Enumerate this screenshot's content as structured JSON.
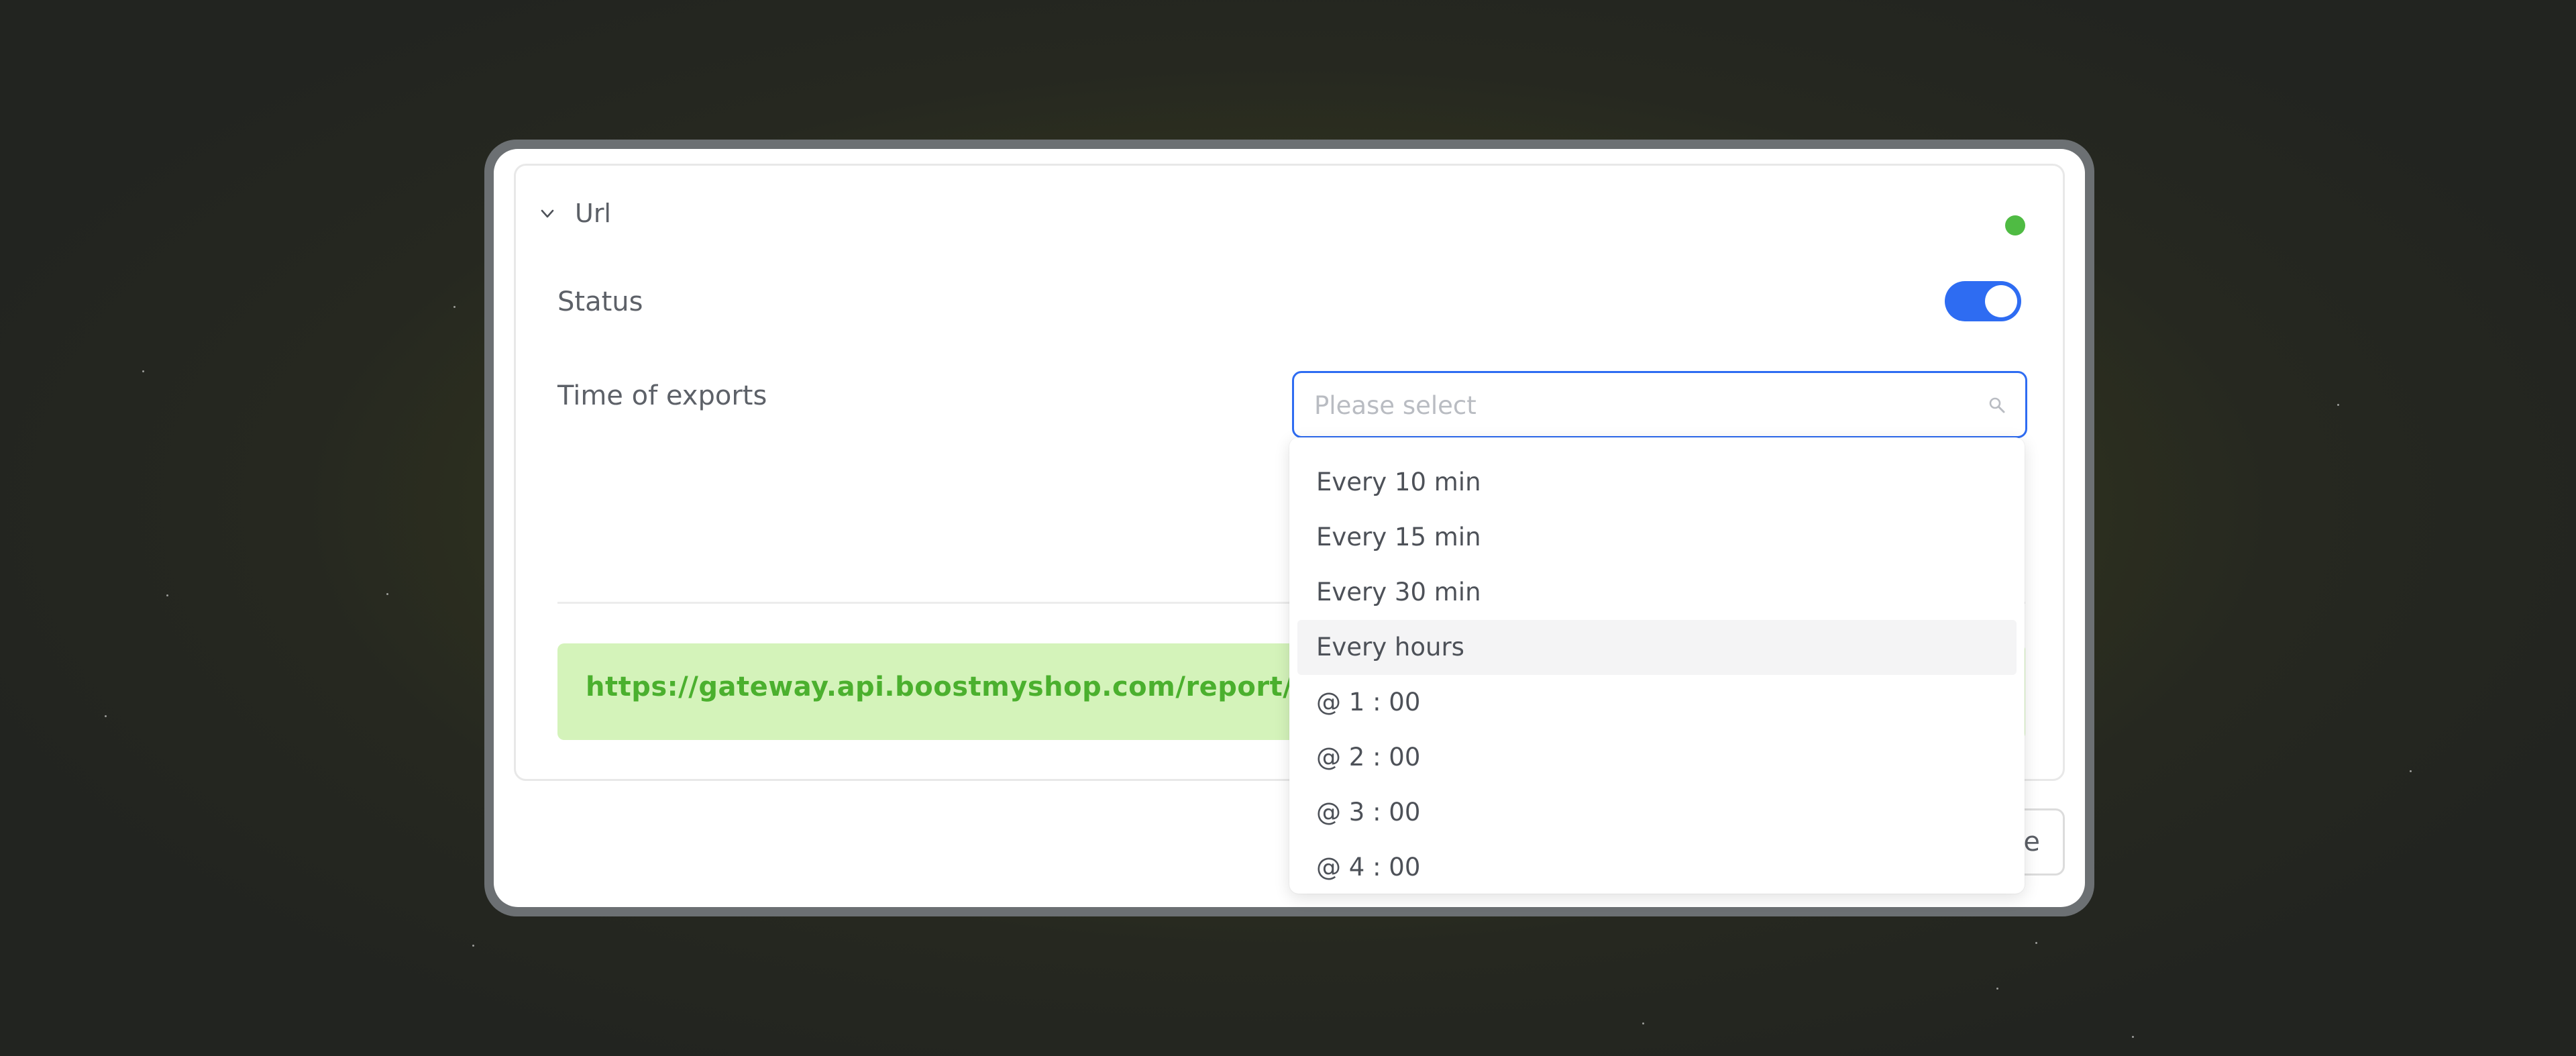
{
  "panel": {
    "title": "Url",
    "status_dot_color": "#4fbb43"
  },
  "fields": {
    "status_label": "Status",
    "status_enabled": true,
    "time_label": "Time of exports",
    "time_placeholder": "Please select",
    "time_value": ""
  },
  "url": {
    "text": "https://gateway.api.boostmyshop.com/report/dow"
  },
  "footer": {
    "save_label_visible": "e"
  },
  "dropdown": {
    "options": [
      "Every 10 min",
      "Every 15 min",
      "Every 30 min",
      "Every hours",
      "@ 1 : 00",
      "@ 2 : 00",
      "@ 3 : 00",
      "@ 4 : 00"
    ],
    "hovered_option": "Every hours"
  },
  "colors": {
    "accent": "#2e6cf2",
    "url_background": "#d4f3ba",
    "url_text": "#4bb02e"
  }
}
